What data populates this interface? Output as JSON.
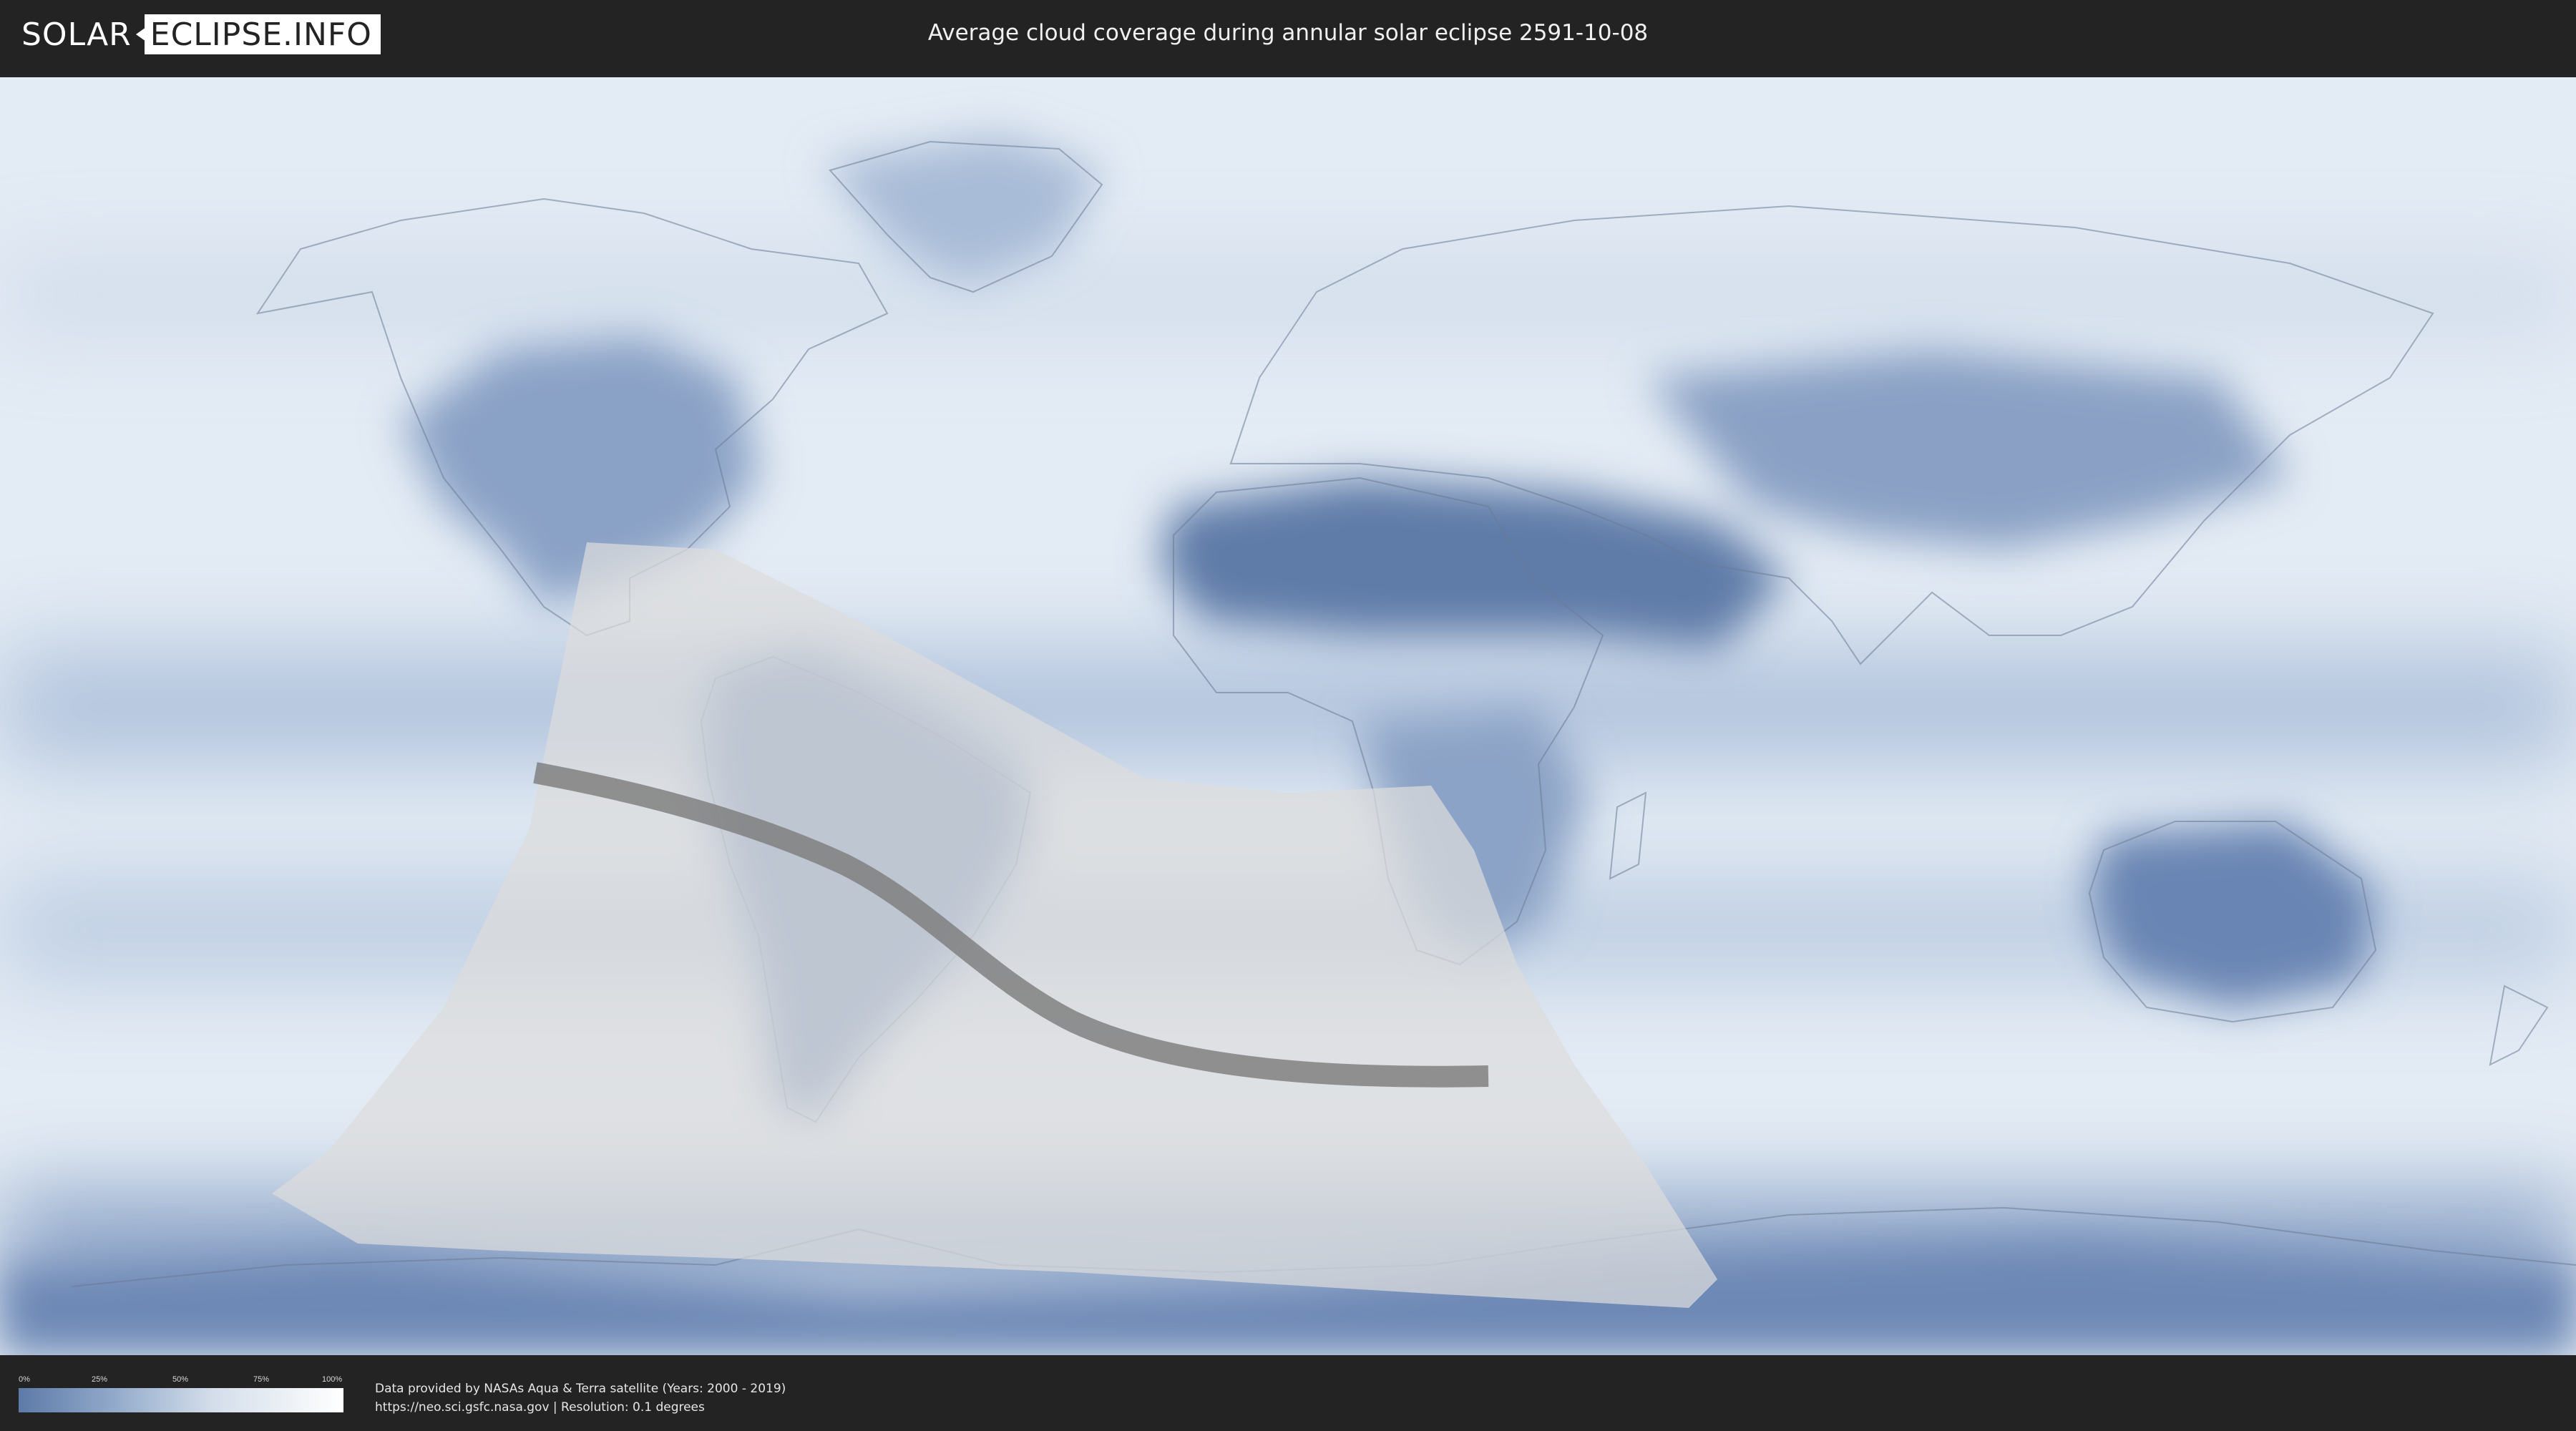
{
  "header": {
    "logo_left": "SOLAR",
    "logo_right": "ECLIPSE.INFO",
    "title": "Average cloud coverage during annular solar eclipse 2591-10-08"
  },
  "legend": {
    "ticks": [
      "0%",
      "25%",
      "50%",
      "75%",
      "100%"
    ],
    "low_color": "#5d7aa8",
    "high_color": "#ffffff"
  },
  "credits": {
    "line1": "Data provided by NASAs Aqua & Terra satellite (Years: 2000 - 2019)",
    "line2": "https://neo.sci.gsfc.nasa.gov | Resolution: 0.1 degrees"
  },
  "map": {
    "projection": "equirectangular world map",
    "ocean_cloud_color": "#e4ecf5",
    "clear_sky_color": "#5f7eaa",
    "penumbra_color": "#d9d9d9",
    "central_path_color": "#7a7a7a"
  }
}
